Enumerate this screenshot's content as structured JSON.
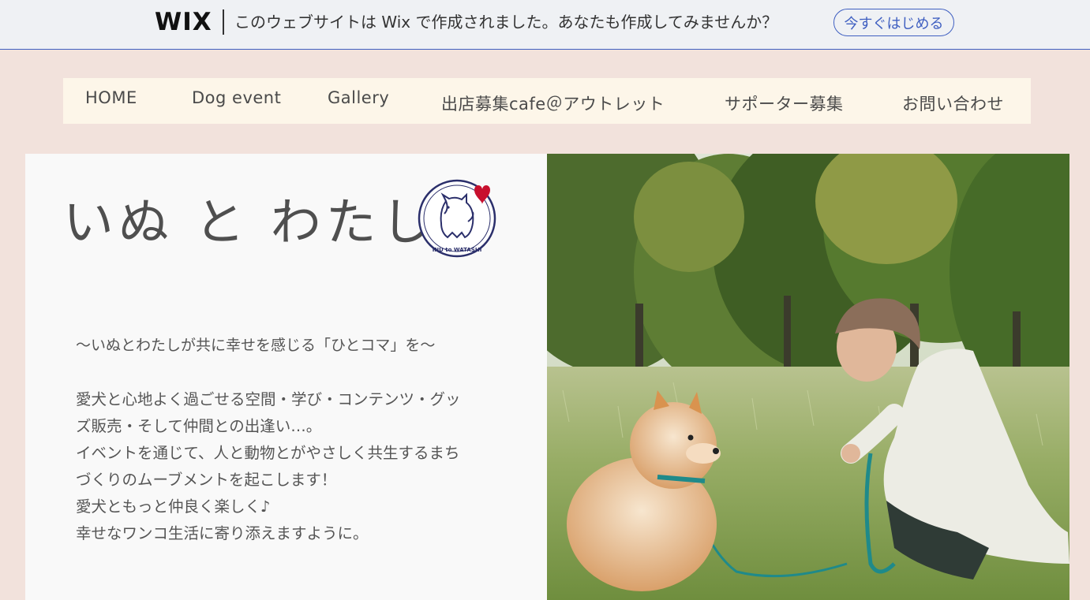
{
  "wix_banner": {
    "logo": "WIX",
    "message": "このウェブサイトは Wix で作成されました。あなたも作成してみませんか？",
    "cta_label": "今すぐはじめる",
    "accent_color": "#3f5fc1"
  },
  "nav": {
    "items": [
      {
        "label": "HOME"
      },
      {
        "label": "Dog event"
      },
      {
        "label": "Gallery"
      },
      {
        "label": "出店募集cafe＠アウトレット"
      },
      {
        "label": "サポーター募集"
      },
      {
        "label": "お問い合わせ"
      }
    ]
  },
  "hero": {
    "title": "いぬ と わたし",
    "logo_text": "INU to WATASHI",
    "tagline": "〜いぬとわたしが共に幸せを感じる「ひとコマ」を〜",
    "description_lines": [
      "愛犬と心地よく過ごせる空間・学び・コンテンツ・グッ",
      "ズ販売・そして仲間との出逢い…。",
      "イベントを通じて、人と動物とがやさしく共生するまち",
      "づくりのムーブメントを起こします！",
      "愛犬ともっと仲良く楽しく♪",
      "幸せなワンコ生活に寄り添えますように。"
    ],
    "photo_icon": "photo-woman-with-pomeranian-in-park"
  },
  "colors": {
    "page_background": "#f2e2dc",
    "nav_background": "#fdf6e9",
    "panel_background": "#f9f9f9",
    "heart": "#c8102e",
    "logo_navy": "#2b2f6b"
  }
}
